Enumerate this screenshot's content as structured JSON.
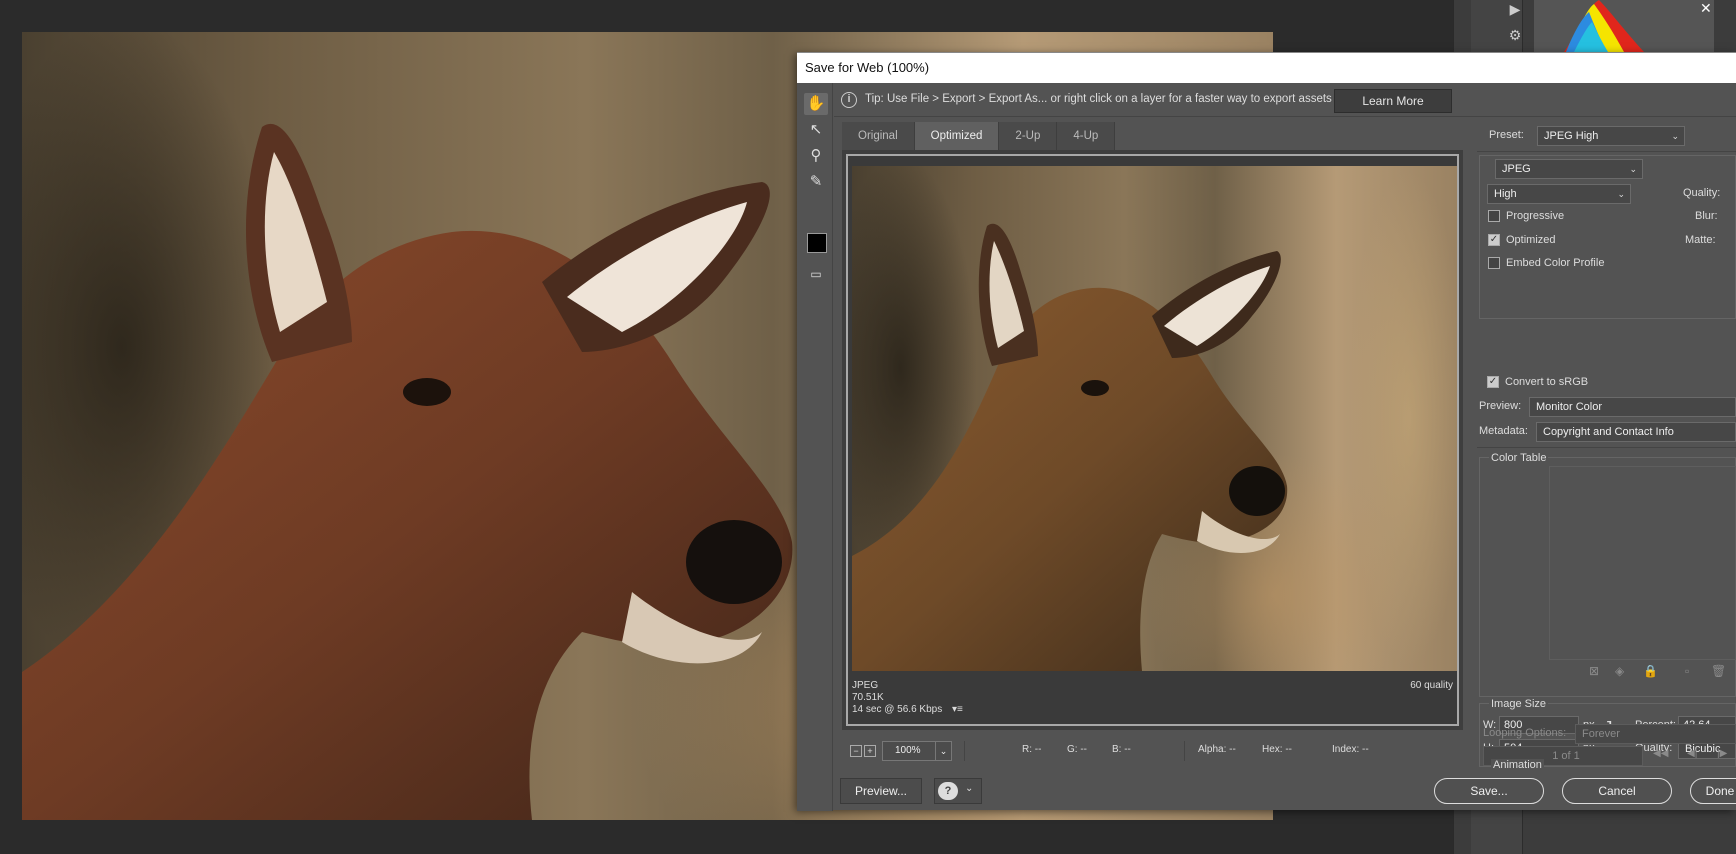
{
  "dialog": {
    "title": "Save for Web (100%)",
    "tip": "Tip: Use File > Export > Export As...  or right click on a layer for a faster way to export assets",
    "learn_more": "Learn More",
    "tabs": [
      "Original",
      "Optimized",
      "2-Up",
      "4-Up"
    ],
    "active_tab": "Optimized"
  },
  "preview": {
    "format": "JPEG",
    "size": "70.51K",
    "download": "14 sec @ 56.6 Kbps",
    "quality": "60 quality"
  },
  "status": {
    "zoom": "100%",
    "r": "R: --",
    "g": "G: --",
    "b": "B: --",
    "alpha": "Alpha: --",
    "hex": "Hex: --",
    "index": "Index: --"
  },
  "buttons": {
    "preview": "Preview...",
    "save": "Save...",
    "cancel": "Cancel",
    "done": "Done"
  },
  "settings": {
    "preset_label": "Preset:",
    "preset": "JPEG High",
    "format": "JPEG",
    "quality_level": "High",
    "quality_label": "Quality:",
    "blur_label": "Blur:",
    "matte_label": "Matte:",
    "progressive": "Progressive",
    "progressive_checked": false,
    "optimized": "Optimized",
    "optimized_checked": true,
    "embed_profile": "Embed Color Profile",
    "embed_checked": false,
    "convert_srgb": "Convert to sRGB",
    "convert_checked": true,
    "preview_label": "Preview:",
    "preview_value": "Monitor Color",
    "metadata_label": "Metadata:",
    "metadata_value": "Copyright and Contact Info",
    "color_table": "Color Table",
    "image_size": "Image Size",
    "w_label": "W:",
    "w_value": "800",
    "h_label": "H:",
    "h_value": "504",
    "px": "px",
    "percent_label": "Percent:",
    "percent_value": "42.64",
    "resample_label": "Quality:",
    "resample_value": "Bicubic",
    "animation": "Animation",
    "looping_label": "Looping Options:",
    "looping_value": "Forever",
    "frame_counter": "1 of 1"
  },
  "colors": {
    "dialog_bg": "#535353",
    "titlebar_bg": "#ffffff",
    "app_bg": "#2b2b2b"
  }
}
